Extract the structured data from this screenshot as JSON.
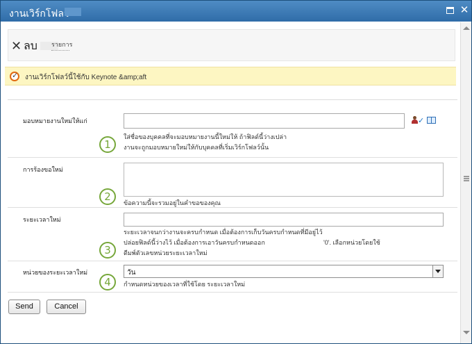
{
  "window": {
    "title": "งานเวิร์กโฟลว์",
    "maximize_icon": "maximize-icon",
    "close_icon": "close-icon",
    "close_glyph": "✕"
  },
  "ribbon": {
    "delete_glyph": "✕",
    "delete_label": "ลบ",
    "group_label": "รายการ"
  },
  "warning": {
    "text": "งานเวิร์กโฟลว์นี้ใช้กับ Keynote &amp;aft"
  },
  "form": {
    "fields": [
      {
        "label": "มอบหมายงานใหม่ให้แก่",
        "help_line1": "ใส่ชื่อของบุคคลที่จะมอบหมายงานนี้ใหม่ให้ ถ้าฟิลด์นี้ว่างเปล่า",
        "help_line2": "งานจะถูกมอบหมายใหม่ให้กับบุคคลที่เริ่มเวิร์กโฟลว์นั้น",
        "callout": "1"
      },
      {
        "label": "การร้องขอใหม่",
        "help_line1": "ข้อความนี้จะรวมอยู่ในคำขอของคุณ",
        "callout": "2"
      },
      {
        "label": "ระยะเวลาใหม่",
        "help_line1": "ระยะเวลาจนกว่างานจะครบกำหนด เมื่อต้องการเก็บวันครบกำหนดที่มีอยู่ไว้",
        "help_line2a": "ปล่อยฟิลด์นี้ว่างไว้ เมื่อต้องการเอาวันครบกำหนดออก",
        "help_line2b": "'0'. เลือกหน่วยโดยใช้",
        "help_line3": "ดีมพ์ตัวเลขหน่วยระยะเวลาใหม่",
        "callout": "3"
      },
      {
        "label": "หน่วยของระยะเวลาใหม่",
        "select_value": "วัน",
        "help_line1": "กำหนดหน่วยของเวลาที่ใช้โดย ระยะเวลาใหม่",
        "callout": "4"
      }
    ]
  },
  "buttons": {
    "send": "Send",
    "cancel": "Cancel"
  },
  "icons": {
    "warning": "workflow-check-icon",
    "people_picker": "check-names-icon",
    "address_book": "address-book-icon"
  },
  "colors": {
    "titlebar": "#2f6ca8",
    "warning_bg": "#fdf6c2",
    "callout": "#76a73a"
  }
}
